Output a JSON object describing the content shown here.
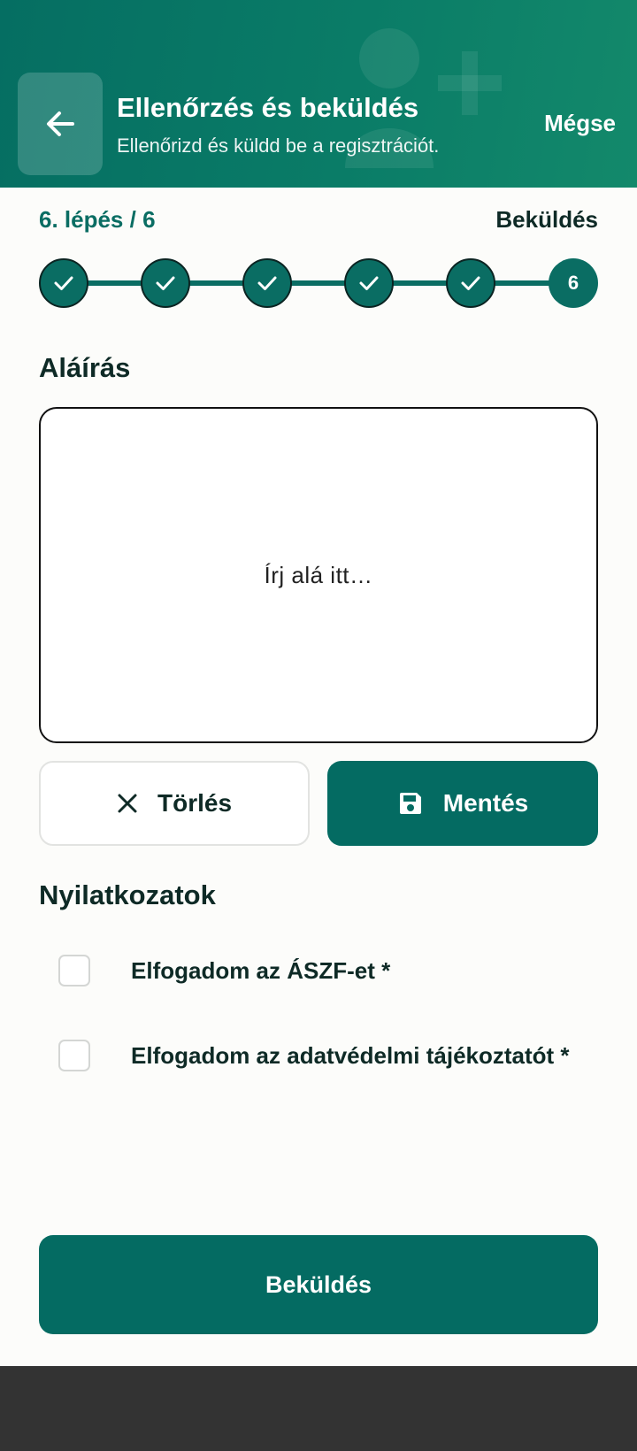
{
  "header": {
    "title": "Ellenőrzés és beküldés",
    "subtitle": "Ellenőrizd és küldd be a regisztrációt.",
    "cancel_label": "Mégse"
  },
  "progress": {
    "label": "6. lépés / 6",
    "step_name": "Beküldés",
    "current_step": 6,
    "total_steps": 6,
    "current_step_label": "6"
  },
  "signature": {
    "title": "Aláírás",
    "placeholder": "Írj alá itt…",
    "clear_label": "Törlés",
    "save_label": "Mentés"
  },
  "declarations": {
    "title": "Nyilatkozatok",
    "items": [
      {
        "label": "Elfogadom az ÁSZF-et *",
        "checked": false
      },
      {
        "label": "Elfogadom az adatvédelmi tájékoztatót *",
        "checked": false
      }
    ]
  },
  "submit_label": "Beküldés",
  "colors": {
    "primary": "#046b62",
    "header_gradient_start": "#056e62",
    "header_gradient_end": "#13896b",
    "text_dark": "#0e2a26",
    "nav_bar": "#333333"
  }
}
